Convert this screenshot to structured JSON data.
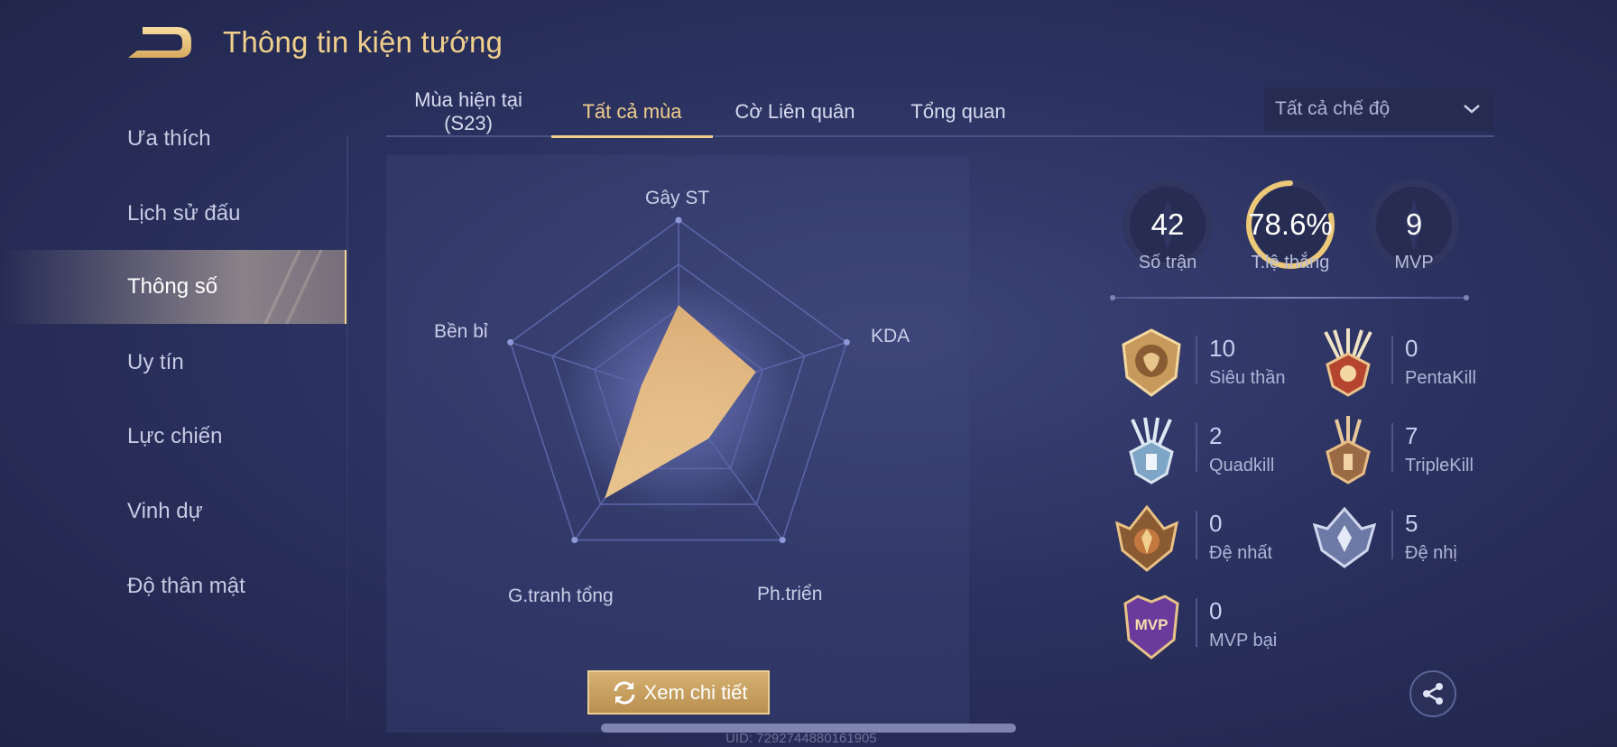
{
  "header": {
    "title": "Thông tin kiện tướng",
    "back_icon": "back-arrow-icon"
  },
  "sidebar": {
    "items": [
      {
        "label": "Ưa thích",
        "active": false
      },
      {
        "label": "Lịch sử đấu",
        "active": false
      },
      {
        "label": "Thông số",
        "active": true
      },
      {
        "label": "Uy tín",
        "active": false
      },
      {
        "label": "Lực chiến",
        "active": false
      },
      {
        "label": "Vinh dự",
        "active": false
      },
      {
        "label": "Độ thân mật",
        "active": false
      }
    ]
  },
  "tabs": [
    {
      "label_line1": "Mùa hiện tại",
      "label_line2": "(S23)",
      "active": false
    },
    {
      "label": "Tất cả mùa",
      "active": true
    },
    {
      "label": "Cờ Liên quân",
      "active": false
    },
    {
      "label": "Tổng quan",
      "active": false
    }
  ],
  "mode_select": {
    "value": "Tất cả chế độ"
  },
  "radar": {
    "axes": [
      "Gây ST",
      "KDA",
      "Ph.triển",
      "G.tranh tổng",
      "Bền bỉ"
    ],
    "values": [
      0.52,
      0.46,
      0.29,
      0.71,
      0.22
    ],
    "fill_color": "#f2c487"
  },
  "detail_button": {
    "label": "Xem chi tiết"
  },
  "summary": {
    "matches": {
      "value": "42",
      "label": "Số trận"
    },
    "winrate": {
      "value": "78.6%",
      "label": "T.lệ thắng",
      "fraction": 0.786
    },
    "mvp": {
      "value": "9",
      "label": "MVP"
    }
  },
  "achievements": [
    {
      "count": "10",
      "label": "Siêu thần",
      "icon": "lion-crest-badge-icon"
    },
    {
      "count": "0",
      "label": "PentaKill",
      "icon": "five-swords-badge-icon"
    },
    {
      "count": "2",
      "label": "Quadkill",
      "icon": "four-swords-badge-icon"
    },
    {
      "count": "7",
      "label": "TripleKill",
      "icon": "three-swords-badge-icon"
    },
    {
      "count": "0",
      "label": "Đệ nhất",
      "icon": "gold-crown-badge-icon"
    },
    {
      "count": "5",
      "label": "Đệ nhị",
      "icon": "silver-badge-icon"
    },
    {
      "count": "0",
      "label": "MVP bại",
      "icon": "purple-mvp-badge-icon"
    }
  ],
  "uid": "UID: 7292744880161905",
  "colors": {
    "accent_gold": "#f0cf8c",
    "background": "#2c3260"
  }
}
